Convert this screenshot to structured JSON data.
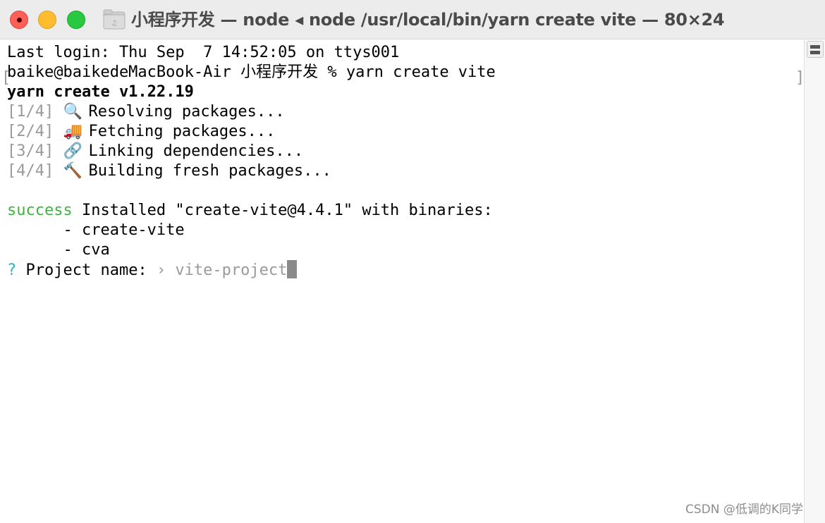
{
  "window": {
    "title": "小程序开发 — node ◂ node /usr/local/bin/yarn create vite — 80×24"
  },
  "terminal": {
    "last_login": "Last login: Thu Sep  7 14:52:05 on ttys001",
    "prompt_line": "baike@baikedeMacBook-Air 小程序开发 % yarn create vite",
    "yarn_header": "yarn create v1.22.19",
    "steps": [
      {
        "num": "[1/4]",
        "icon": "🔍",
        "icon_name": "magnifier-icon",
        "text": "Resolving packages..."
      },
      {
        "num": "[2/4]",
        "icon": "🚚",
        "icon_name": "truck-icon",
        "text": "Fetching packages..."
      },
      {
        "num": "[3/4]",
        "icon": "🔗",
        "icon_name": "link-icon",
        "text": "Linking dependencies..."
      },
      {
        "num": "[4/4]",
        "icon": "🔨",
        "icon_name": "hammer-icon",
        "text": "Building fresh packages..."
      }
    ],
    "success_word": "success",
    "success_rest": " Installed \"create-vite@4.4.1\" with binaries:",
    "binaries": [
      "      - create-vite",
      "      - cva"
    ],
    "question_mark": "?",
    "question_label": " Project name: ",
    "question_arrow": "›",
    "question_default": " vite-project"
  },
  "watermark": "CSDN @低调的K同学",
  "colors": {
    "success": "#3fb33f",
    "question": "#2bb3c0",
    "step_number": "#9a9a9a",
    "close": "#fe5f57",
    "minimize": "#febc2e",
    "maximize": "#28c840"
  }
}
